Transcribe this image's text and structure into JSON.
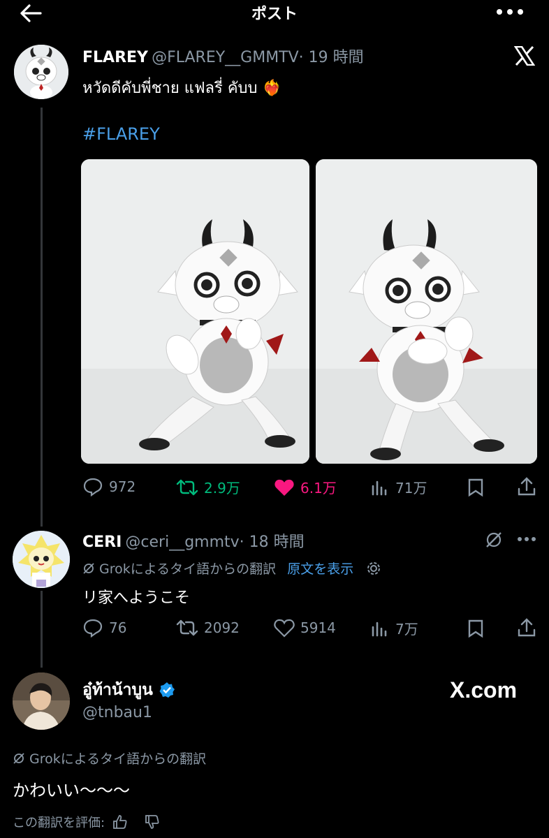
{
  "header": {
    "title": "ポスト"
  },
  "post": {
    "name": "FLAREY",
    "handle": "@FLAREY__GMMTV",
    "time": "· 19 時間",
    "text": "หวัดดีคับพี่ชาย แฟลรี่ คับบ",
    "emoji": "❤️‍🔥",
    "hashtag": "#FLAREY",
    "stats": {
      "replies": "972",
      "reposts": "2.9万",
      "likes": "6.1万",
      "views": "71万"
    }
  },
  "reply1": {
    "name": "CERI",
    "handle": "@ceri__gmmtv",
    "time": "· 18 時間",
    "translate_note": "Grokによるタイ語からの翻訳",
    "show_original": "原文を表示",
    "text": "リ家へようこそ",
    "stats": {
      "replies": "76",
      "reposts": "2092",
      "likes": "5914",
      "views": "7万"
    }
  },
  "reply2": {
    "name": "อู๋ท้าน้าบูน",
    "handle": "@tnbau1",
    "brand": "X.com",
    "translate_note": "Grokによるタイ語からの翻訳",
    "text": "かわいい〜〜〜",
    "rate_label": "この翻訳を評価:"
  },
  "colors": {
    "accent": "#4a9fe8",
    "like": "#f91880",
    "repost": "#00ba7c"
  }
}
